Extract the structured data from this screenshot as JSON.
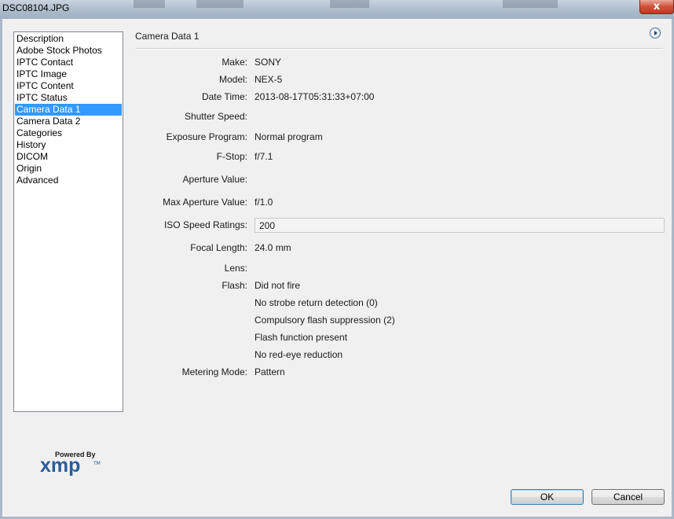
{
  "window": {
    "title": "DSC08104.JPG",
    "close_label": "x"
  },
  "sidebar": {
    "items": [
      {
        "label": "Description"
      },
      {
        "label": "Adobe Stock Photos"
      },
      {
        "label": "IPTC Contact"
      },
      {
        "label": "IPTC Image"
      },
      {
        "label": "IPTC Content"
      },
      {
        "label": "IPTC Status"
      },
      {
        "label": "Camera Data 1",
        "selected": true
      },
      {
        "label": "Camera Data 2"
      },
      {
        "label": "Categories"
      },
      {
        "label": "History"
      },
      {
        "label": "DICOM"
      },
      {
        "label": "Origin"
      },
      {
        "label": "Advanced"
      }
    ]
  },
  "panel": {
    "title": "Camera Data 1",
    "fields": {
      "make": {
        "label": "Make:",
        "value": "SONY"
      },
      "model": {
        "label": "Model:",
        "value": "NEX-5"
      },
      "date_time": {
        "label": "Date Time:",
        "value": "2013-08-17T05:31:33+07:00"
      },
      "shutter_speed": {
        "label": "Shutter Speed:",
        "value": ""
      },
      "exposure_program": {
        "label": "Exposure Program:",
        "value": "Normal program"
      },
      "f_stop": {
        "label": "F-Stop:",
        "value": "f/7.1"
      },
      "aperture_value": {
        "label": "Aperture Value:",
        "value": ""
      },
      "max_aperture_value": {
        "label": "Max Aperture Value:",
        "value": "f/1.0"
      },
      "iso_speed_ratings": {
        "label": "ISO Speed Ratings:",
        "value": "200"
      },
      "focal_length": {
        "label": "Focal Length:",
        "value": "24.0 mm"
      },
      "lens": {
        "label": "Lens:",
        "value": ""
      },
      "flash": {
        "label": "Flash:",
        "values": [
          "Did not fire",
          "No strobe return detection (0)",
          "Compulsory flash suppression (2)",
          "Flash function present",
          "No red-eye reduction"
        ]
      },
      "metering_mode": {
        "label": "Metering Mode:",
        "value": "Pattern"
      }
    }
  },
  "logo": {
    "powered_by": "Powered By",
    "brand": "xmp",
    "tm": "TM"
  },
  "buttons": {
    "ok_label": "OK",
    "cancel_label": "Cancel"
  },
  "icons": {
    "flyout": "flyout-menu-icon",
    "close": "close-icon"
  },
  "colors": {
    "selection": "#3399ff",
    "xmp_blue": "#2a5d9a"
  }
}
